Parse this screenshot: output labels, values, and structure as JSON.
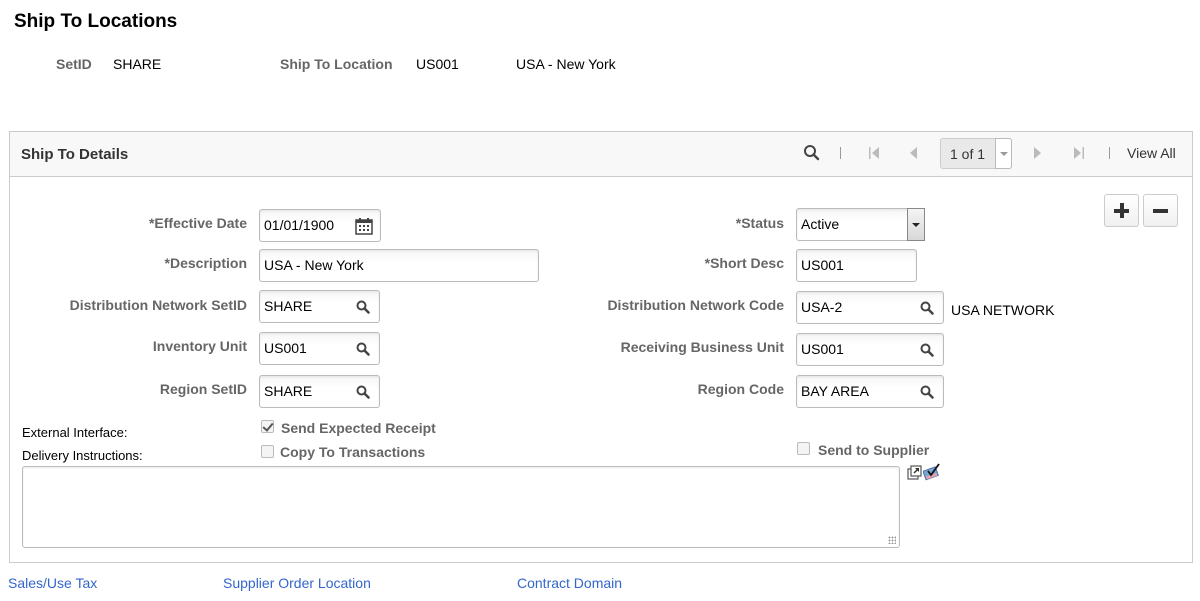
{
  "page": {
    "title": "Ship To Locations"
  },
  "header": {
    "setid_label": "SetID",
    "setid_value": "SHARE",
    "ship_to_label": "Ship To Location",
    "ship_to_value": "US001",
    "ship_to_desc": "USA - New York"
  },
  "panel": {
    "title": "Ship To Details",
    "nav": {
      "search_icon": "search-icon",
      "first_icon": "first-page-icon",
      "prev_icon": "previous-icon",
      "pager_text": "1 of 1",
      "next_icon": "next-icon",
      "last_icon": "last-page-icon",
      "view_all": "View All"
    },
    "add_row_icon": "plus-icon",
    "delete_row_icon": "minus-icon"
  },
  "form": {
    "effective_date": {
      "label": "*Effective Date",
      "value": "01/01/1900",
      "icon": "calendar-icon"
    },
    "description": {
      "label": "*Description",
      "value": "USA - New York"
    },
    "dist_network_setid": {
      "label": "Distribution Network SetID",
      "value": "SHARE",
      "icon": "lookup-icon"
    },
    "inventory_unit": {
      "label": "Inventory Unit",
      "value": "US001",
      "icon": "lookup-icon"
    },
    "region_setid": {
      "label": "Region SetID",
      "value": "SHARE",
      "icon": "lookup-icon"
    },
    "status": {
      "label": "*Status",
      "value": "Active"
    },
    "short_desc": {
      "label": "*Short Desc",
      "value": "US001"
    },
    "dist_network_code": {
      "label": "Distribution Network Code",
      "value": "USA-2",
      "desc": "USA NETWORK",
      "icon": "lookup-icon"
    },
    "receiving_bu": {
      "label": "Receiving Business Unit",
      "value": "US001",
      "icon": "lookup-icon"
    },
    "region_code": {
      "label": "Region Code",
      "value": "BAY AREA",
      "icon": "lookup-icon"
    },
    "external_interface_label": "External Interface:",
    "send_expected_receipt": {
      "label": "Send Expected Receipt",
      "checked": true
    },
    "copy_to_transactions": {
      "label": "Copy To Transactions",
      "checked": false
    },
    "send_to_supplier": {
      "label": "Send to Supplier",
      "checked": false
    },
    "delivery_instructions_label": "Delivery Instructions:",
    "delivery_instructions_value": "",
    "expand_icon": "expand-text-icon",
    "spellcheck_icon": "spell-check-icon"
  },
  "links": {
    "sales_use_tax": "Sales/Use Tax",
    "supplier_order_location": "Supplier Order Location",
    "contract_domain": "Contract Domain"
  }
}
